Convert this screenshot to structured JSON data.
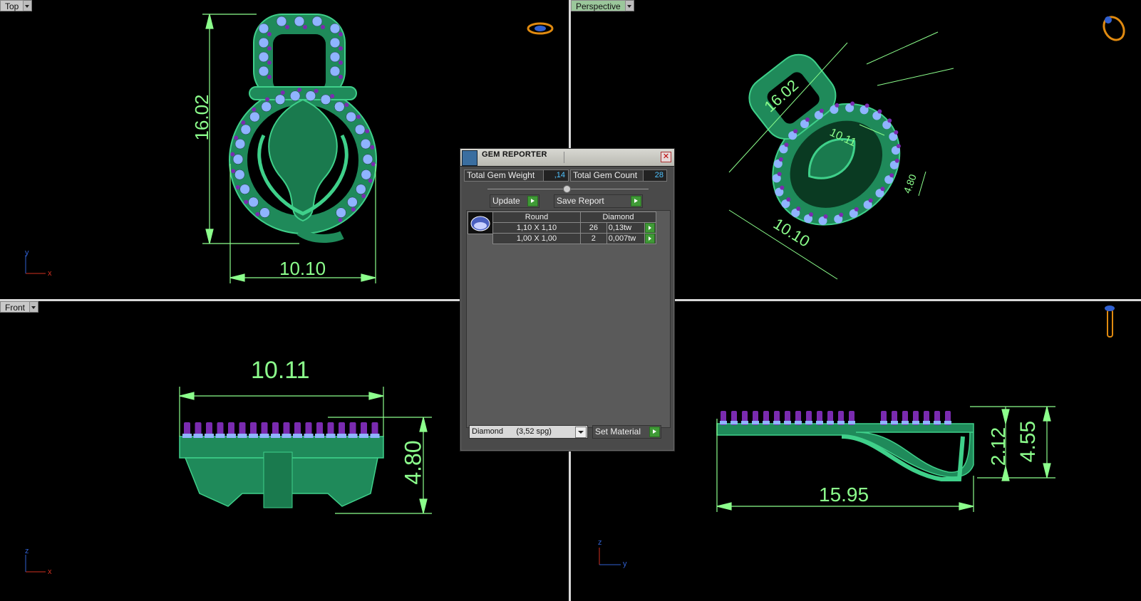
{
  "viewports": {
    "top": {
      "label": "Top",
      "dims": [
        "16.02",
        "10.10"
      ],
      "axis": [
        "y",
        "x"
      ]
    },
    "perspective": {
      "label": "Perspective",
      "dims": [
        "16.02",
        "10.10",
        "4.80",
        "10.11"
      ]
    },
    "front": {
      "label": "Front",
      "dims": [
        "10.11",
        "4.80"
      ],
      "axis": [
        "z",
        "x"
      ]
    },
    "right": {
      "dims": [
        "15.95",
        "2.12",
        "4.55"
      ],
      "axis": [
        "z",
        "y"
      ]
    }
  },
  "gem_reporter": {
    "title": "GEM REPORTER",
    "total_weight_label": "Total Gem Weight",
    "total_weight": ",14",
    "total_count_label": "Total Gem Count",
    "total_count": "28",
    "update_label": "Update",
    "save_report_label": "Save Report",
    "table": {
      "headers": [
        "Round",
        "Diamond"
      ],
      "rows": [
        {
          "size": "1,10 X 1,10",
          "count": "26",
          "weight": "0,13tw"
        },
        {
          "size": "1,00 X 1,00",
          "count": "2",
          "weight": "0,007tw"
        }
      ]
    },
    "material": "Diamond      (3,52 spg)",
    "set_material_label": "Set Material"
  },
  "colors": {
    "body": "#1f8a5a",
    "body_edge": "#3fd08a",
    "gem": "#8fb4ff",
    "prong": "#7a2bb0",
    "dimension": "#8cff8c"
  },
  "icons": [
    "ring-top-icon",
    "ring-perspective-icon",
    "ring-side-icon",
    "close-icon"
  ]
}
